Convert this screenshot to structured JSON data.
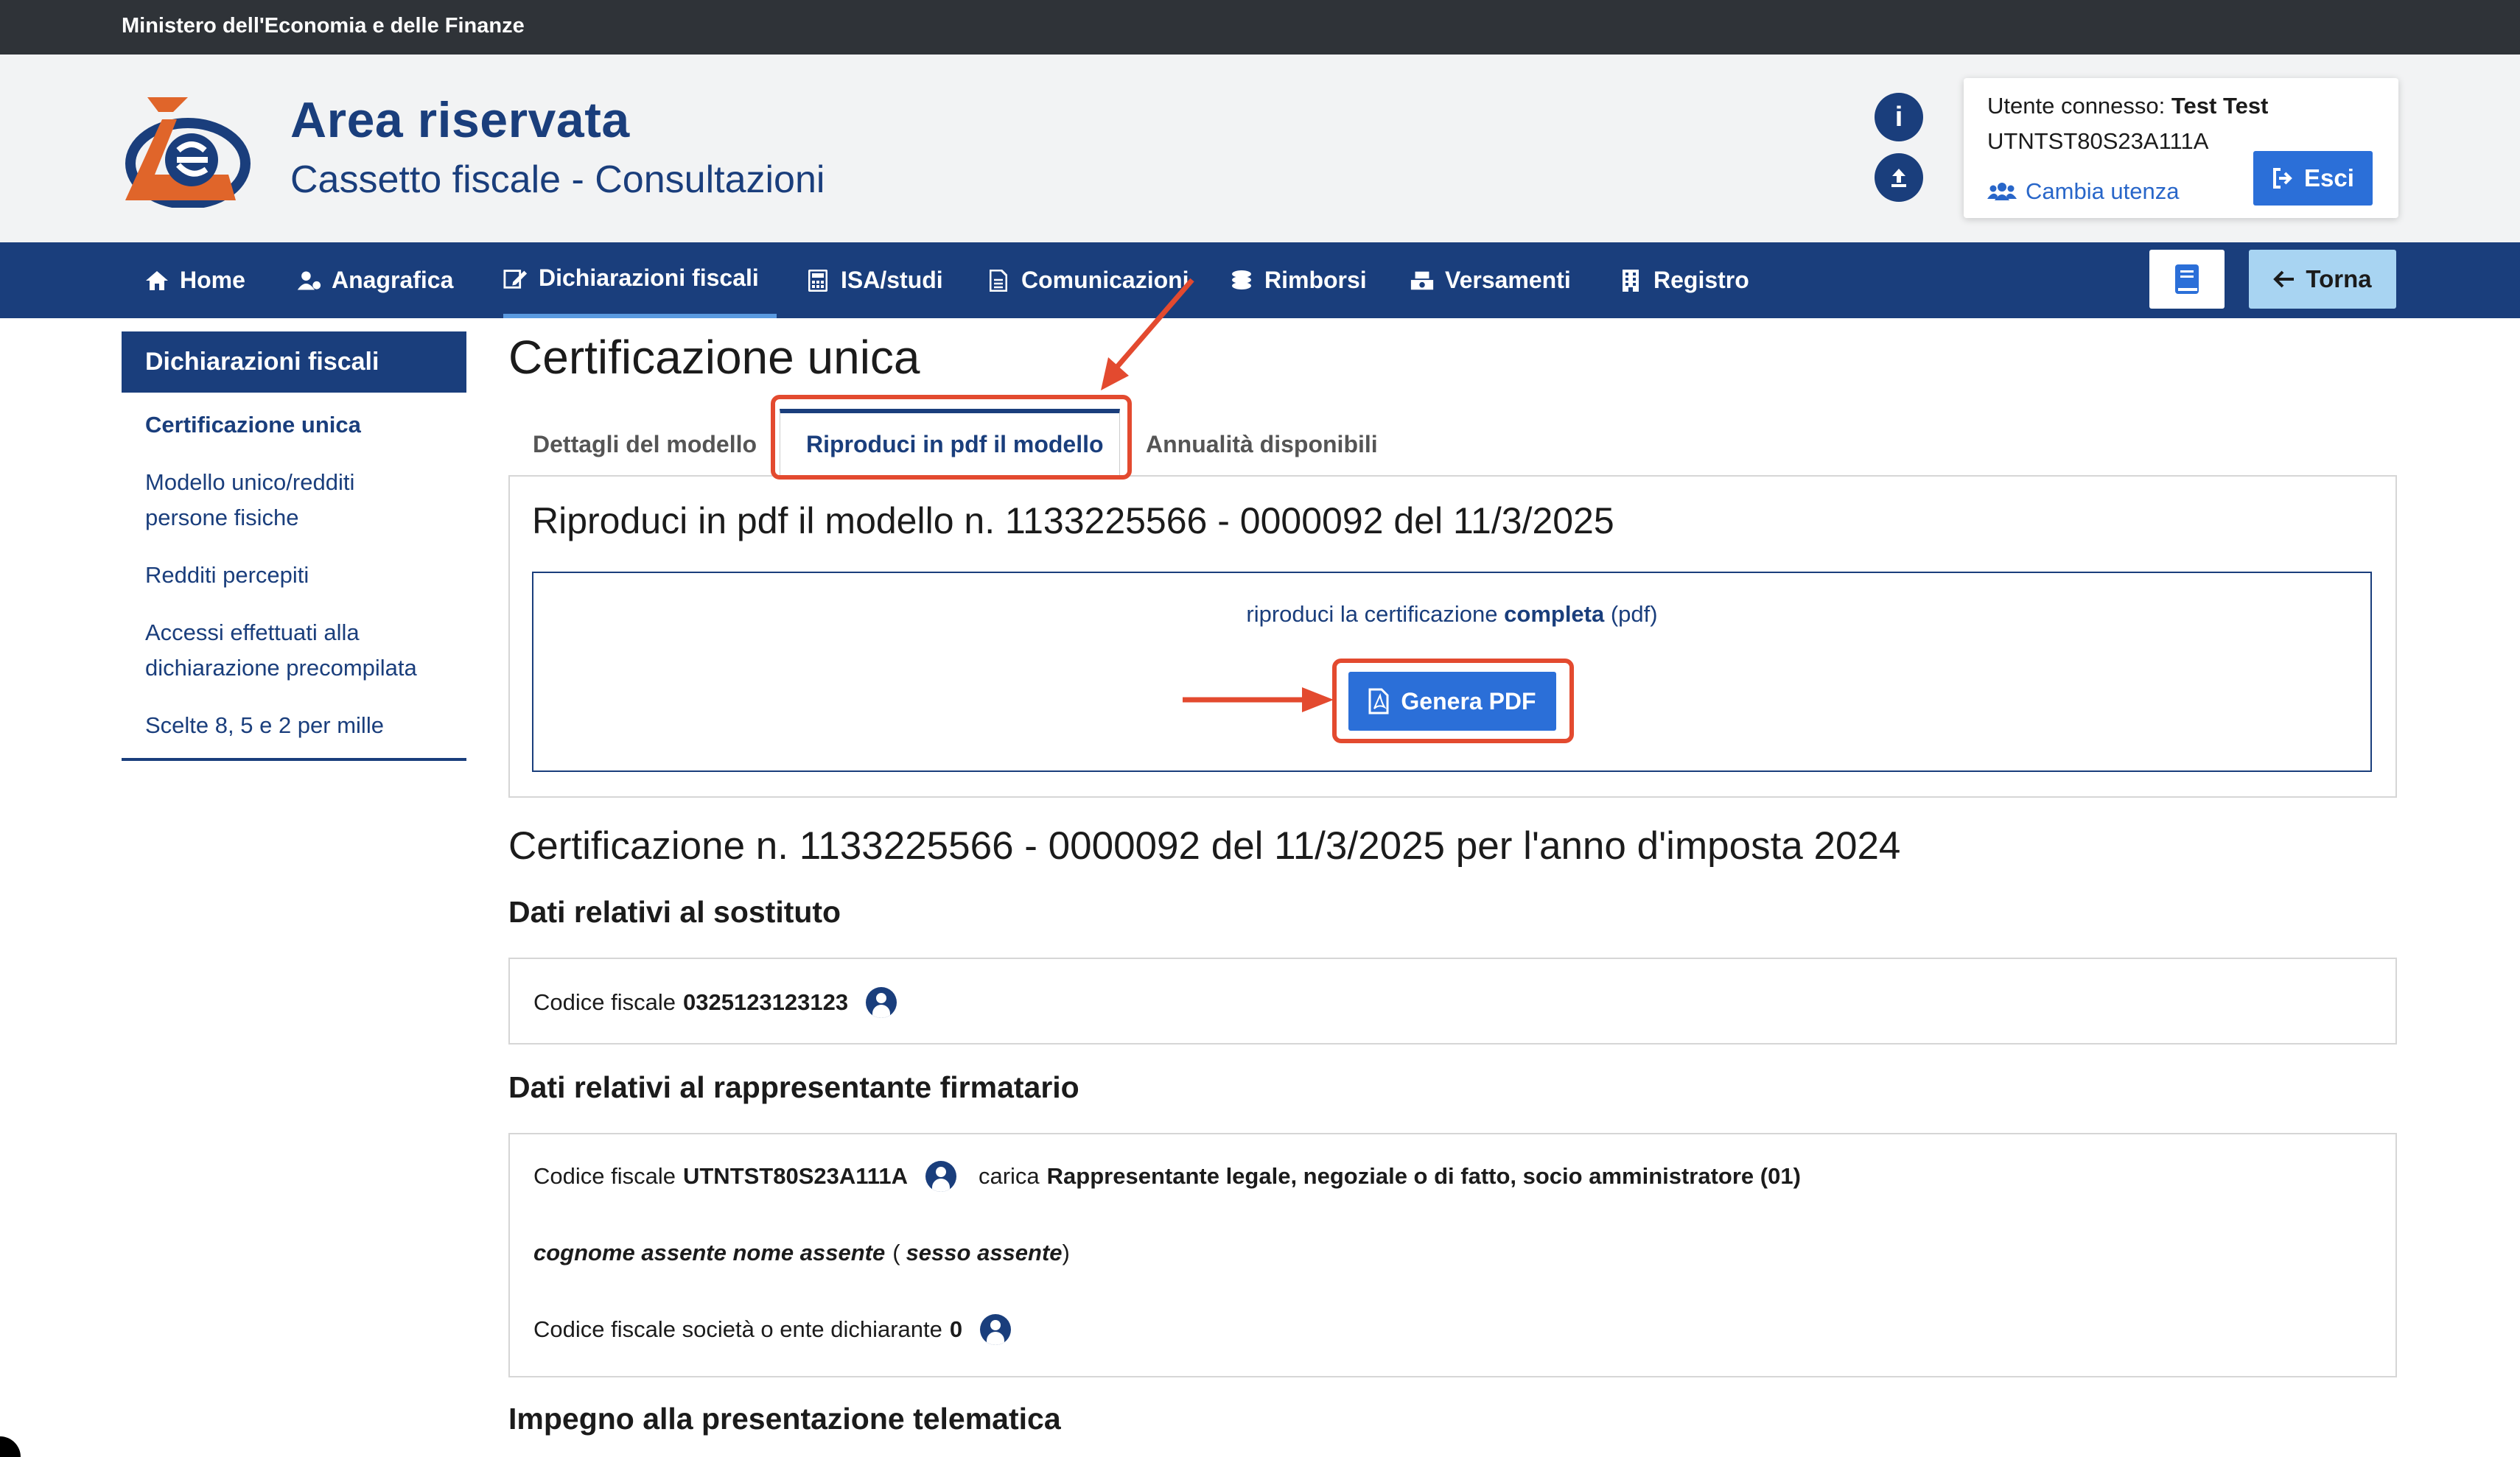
{
  "topbar": {
    "title": "Ministero dell'Economia e delle Finanze"
  },
  "header": {
    "title": "Area riservata",
    "subtitle": "Cassetto fiscale - Consultazioni",
    "user": {
      "label": "Utente connesso:",
      "name": "Test Test",
      "code": "UTNTST80S23A111A",
      "switch_label": "Cambia utenza",
      "logout_label": "Esci"
    }
  },
  "nav": {
    "items": [
      {
        "label": "Home",
        "icon": "home-icon"
      },
      {
        "label": "Anagrafica",
        "icon": "user-icon"
      },
      {
        "label": "Dichiarazioni fiscali",
        "icon": "edit-icon"
      },
      {
        "label": "ISA/studi",
        "icon": "calculator-icon"
      },
      {
        "label": "Comunicazioni",
        "icon": "document-icon"
      },
      {
        "label": "Rimborsi",
        "icon": "coins-icon"
      },
      {
        "label": "Versamenti",
        "icon": "cash-icon"
      },
      {
        "label": "Registro",
        "icon": "building-icon"
      }
    ],
    "back_label": "Torna"
  },
  "sidebar": {
    "title": "Dichiarazioni fiscali",
    "items": [
      {
        "label": "Certificazione unica"
      },
      {
        "label": "Modello unico/redditi"
      },
      {
        "label": "persone fisiche"
      },
      {
        "label": "Redditi percepiti"
      },
      {
        "label": "Accessi effettuati alla"
      },
      {
        "label": "dichiarazione precompilata"
      },
      {
        "label": "Scelte 8, 5 e 2 per mille"
      }
    ]
  },
  "main": {
    "title": "Certificazione unica",
    "tabs": [
      {
        "label": "Dettagli del modello"
      },
      {
        "label": "Riproduci in pdf il modello"
      },
      {
        "label": "Annualità disponibili"
      }
    ],
    "pdf_panel": {
      "title": "Riproduci in pdf il modello n. 1133225566 - 0000092 del 11/3/2025",
      "text_before": "riproduci la certificazione ",
      "text_bold": "completa",
      "text_after": " (pdf)",
      "button_label": "Genera PDF"
    },
    "cert_title": "Certificazione n. 1133225566 - 0000092 del 11/3/2025 per l'anno d'imposta 2024",
    "sostituto": {
      "heading": "Dati relativi al sostituto",
      "cf_label": "Codice fiscale",
      "cf_value": "0325123123123"
    },
    "rappresentante": {
      "heading": "Dati relativi al rappresentante firmatario",
      "cf_label": "Codice fiscale",
      "cf_value": "UTNTST80S23A111A",
      "carica_label": "carica",
      "carica_value": "Rappresentante legale, negoziale o di fatto, socio amministratore (01)",
      "name_value": "cognome assente nome assente",
      "paren_open": "(",
      "sex_value": "sesso assente",
      "paren_close": ")",
      "societa_label": "Codice fiscale società o ente dichiarante",
      "societa_value": "0"
    },
    "impegno_heading": "Impegno alla presentazione telematica"
  }
}
